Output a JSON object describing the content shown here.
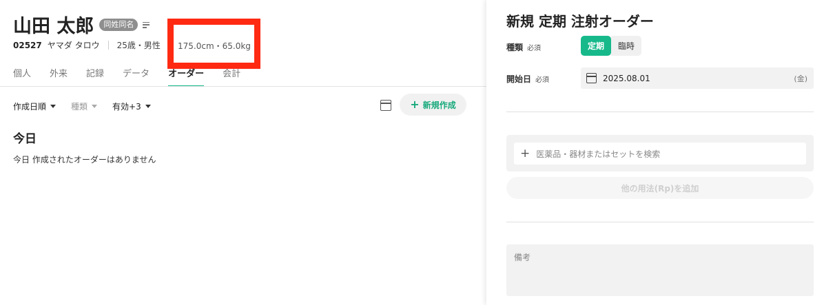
{
  "patient": {
    "name": "山田 太郎",
    "same_name_badge": "同姓同名",
    "id": "02527",
    "kana": "ヤマダ タロウ",
    "age_sex": "25歳・男性",
    "body_metrics": "175.0cm・65.0kg"
  },
  "tabs": [
    {
      "label": "個人"
    },
    {
      "label": "外来"
    },
    {
      "label": "記録"
    },
    {
      "label": "データ"
    },
    {
      "label": "オーダー",
      "active": true
    },
    {
      "label": "会計"
    }
  ],
  "filters": {
    "sort": "作成日順",
    "kind": "種類",
    "status": "有効+3"
  },
  "new_button_label": "新規作成",
  "section": {
    "title": "今日",
    "empty_text": "今日 作成されたオーダーはありません"
  },
  "order_form": {
    "title": "新規 定期 注射オーダー",
    "type_label": "種類",
    "required": "必須",
    "type_options": [
      "定期",
      "臨時"
    ],
    "type_selected": "定期",
    "start_label": "開始日",
    "start_date": "2025.08.01",
    "start_weekday": "(金)",
    "search_placeholder": "医薬品・器材またはセットを検索",
    "add_rp_label": "他の用法(Rp)を追加",
    "notes_placeholder": "備考"
  },
  "colors": {
    "accent": "#17b98b",
    "highlight": "#ff2a12"
  }
}
